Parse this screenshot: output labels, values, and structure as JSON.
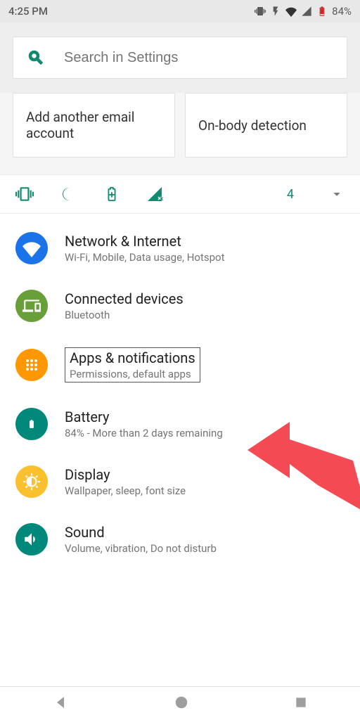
{
  "status": {
    "time": "4:25 PM",
    "battery_pct": "84%"
  },
  "search": {
    "placeholder": "Search in Settings"
  },
  "tiles": {
    "add_email": "Add another email account",
    "onbody": "On-body detection"
  },
  "qs": {
    "count": "4"
  },
  "settings": {
    "network": {
      "title": "Network & Internet",
      "sub": "Wi-Fi, Mobile, Data usage, Hotspot"
    },
    "connected": {
      "title": "Connected devices",
      "sub": "Bluetooth"
    },
    "apps": {
      "title": "Apps & notifications",
      "sub": "Permissions, default apps"
    },
    "battery": {
      "title": "Battery",
      "sub": "84% - More than 2 days remaining"
    },
    "display": {
      "title": "Display",
      "sub": "Wallpaper, sleep, font size"
    },
    "sound": {
      "title": "Sound",
      "sub": "Volume, vibration, Do not disturb"
    }
  }
}
